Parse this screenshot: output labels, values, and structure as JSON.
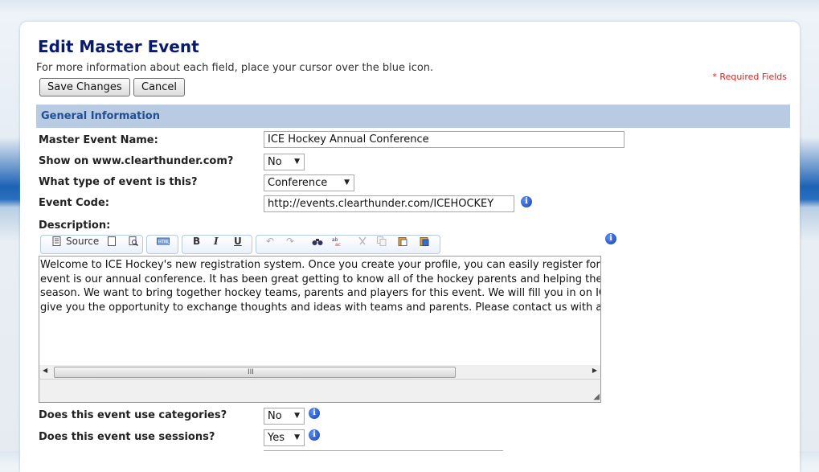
{
  "page": {
    "title": "Edit Master Event",
    "intro": "For more information about each field, place your cursor over the blue icon.",
    "required_note": "* Required Fields"
  },
  "buttons": {
    "save": "Save Changes",
    "cancel": "Cancel"
  },
  "section": {
    "title": "General Information"
  },
  "fields": {
    "master_event_name": {
      "label": "Master Event Name:",
      "value": "ICE Hockey Annual Conference"
    },
    "show_on_site": {
      "label": "Show on www.clearthunder.com?",
      "value": "No"
    },
    "event_type": {
      "label": "What type of event is this?",
      "value": "Conference"
    },
    "event_code": {
      "label": "Event Code:",
      "value": "http://events.clearthunder.com/ICEHOCKEY"
    },
    "description": {
      "label": "Description:"
    },
    "categories": {
      "label": "Does this event use categories?",
      "value": "No"
    },
    "sessions": {
      "label": "Does this event use sessions?",
      "value": "Yes"
    }
  },
  "editor": {
    "toolbar": {
      "source_label": "Source",
      "bold": "B",
      "italic": "I",
      "underline": "U"
    },
    "content": "Welcome to ICE Hockey's new registration system.  Once you create your profile, you can easily register for all\nevent is our annual conference.  It has been great getting to know all of the hockey parents and helping them\nseason.  We want to bring together hockey teams, parents and players for this event.  We will fill you in on ICE\ngive you the opportunity to exchange thoughts and ideas with teams and parents. Please contact us with any",
    "scroll_grip": "III"
  },
  "icons": {
    "info": "info-icon",
    "arrow": "dropdown-arrow-icon"
  },
  "colors": {
    "title": "#0a1a6a",
    "section_bg": "#b8cbe2",
    "section_text": "#1f4e96",
    "required": "#dd2222",
    "info": "#1342b8"
  }
}
